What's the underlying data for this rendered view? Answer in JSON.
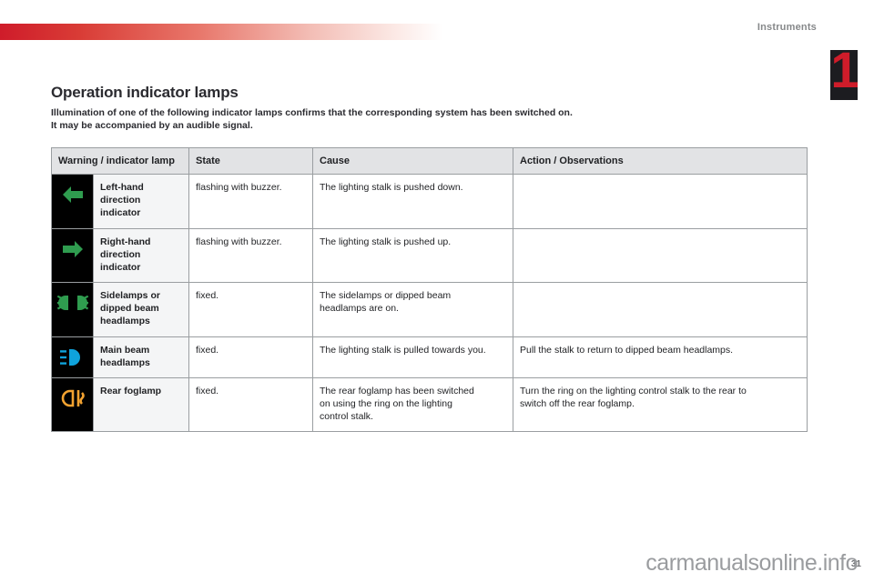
{
  "header": {
    "chapter_title": "Instruments",
    "chapter_number": "1"
  },
  "page": {
    "heading": "Operation indicator lamps",
    "intro_line1": "Illumination of one of the following indicator lamps confirms that the corresponding system has been switched on.",
    "intro_line2": "It may be accompanied by an audible signal.",
    "page_number": "31"
  },
  "watermark": {
    "text": "carmanualsonline.info"
  },
  "colors": {
    "accent_red": "#cf1c2a",
    "header_gray": "#e2e3e5",
    "green_indicator": "#2f9c4f",
    "blue_beam": "#0fa3dc",
    "orange_fog": "#f2a230"
  },
  "table": {
    "headers": [
      "Warning / indicator lamp",
      "State",
      "Cause",
      "Action / Observations"
    ],
    "rows": [
      {
        "icon": "left-arrow-indicator-icon",
        "name_line1": "Left-hand",
        "name_line2": "direction indicator",
        "name_line3": "",
        "state": "flashing with buzzer.",
        "cause_line1": "The lighting stalk is pushed down.",
        "cause_line2": "",
        "cause_line3": "",
        "action_line1": "",
        "action_line2": ""
      },
      {
        "icon": "right-arrow-indicator-icon",
        "name_line1": "Right-hand",
        "name_line2": "direction indicator",
        "name_line3": "",
        "state": "flashing with buzzer.",
        "cause_line1": "The lighting stalk is pushed up.",
        "cause_line2": "",
        "cause_line3": "",
        "action_line1": "",
        "action_line2": ""
      },
      {
        "icon": "sidelamps-dipped-beam-icon",
        "name_line1": "Sidelamps or",
        "name_line2": "dipped beam",
        "name_line3": "headlamps",
        "state": "fixed.",
        "cause_line1": "The sidelamps or dipped beam",
        "cause_line2": "headlamps are on.",
        "cause_line3": "",
        "action_line1": "",
        "action_line2": ""
      },
      {
        "icon": "main-beam-headlamps-icon",
        "name_line1": "Main beam",
        "name_line2": "headlamps",
        "name_line3": "",
        "state": "fixed.",
        "cause_line1": "The lighting stalk is pulled towards you.",
        "cause_line2": "",
        "cause_line3": "",
        "action_line1": "Pull the stalk to return to dipped beam headlamps.",
        "action_line2": ""
      },
      {
        "icon": "rear-foglamp-icon",
        "name_line1": "Rear foglamp",
        "name_line2": "",
        "name_line3": "",
        "state": "fixed.",
        "cause_line1": "The rear foglamp has been switched",
        "cause_line2": "on using the ring on the lighting",
        "cause_line3": "control stalk.",
        "action_line1": "Turn the ring on the lighting control stalk to the rear to",
        "action_line2": "switch off the rear foglamp."
      }
    ]
  }
}
